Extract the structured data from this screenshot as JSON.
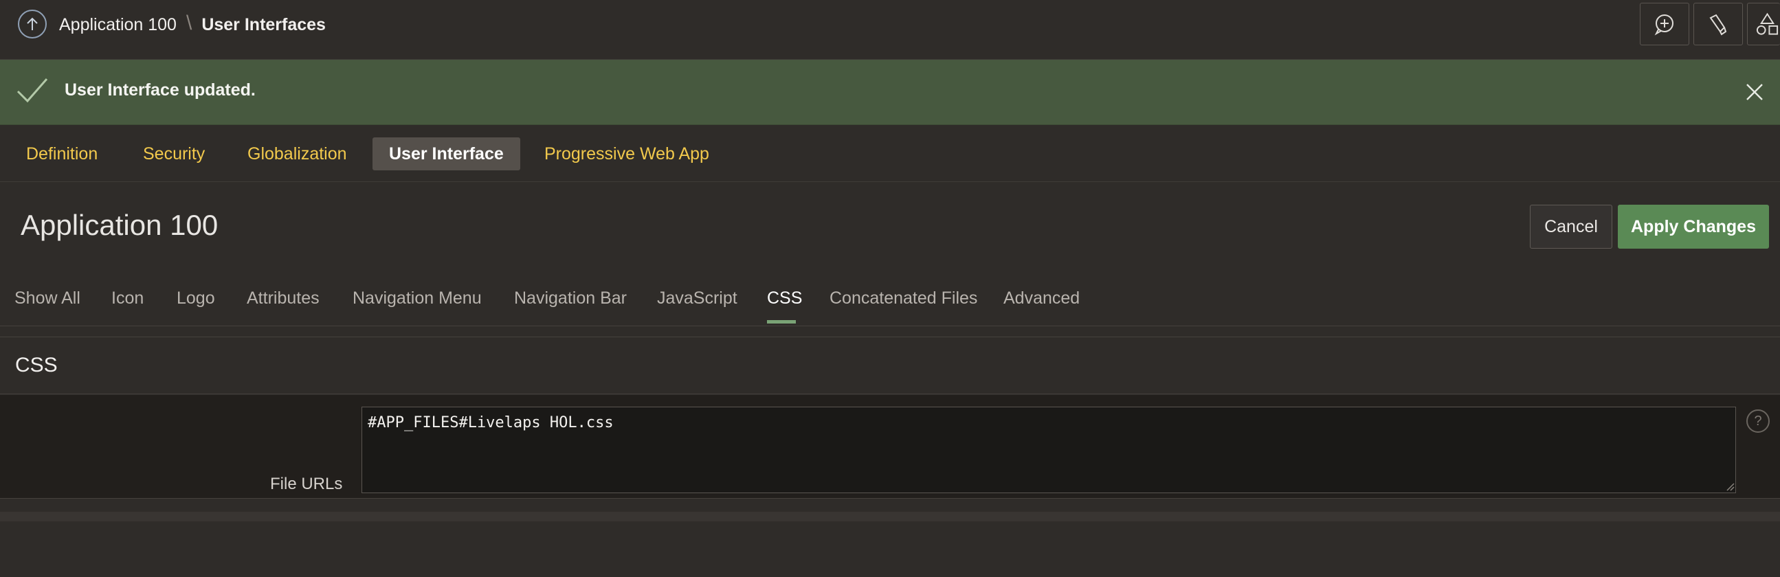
{
  "breadcrumb": {
    "items": [
      "Application 100",
      "User Interfaces"
    ],
    "separator": "\\"
  },
  "toolbar": {
    "icons": [
      "comment-add-icon",
      "highlighter-icon",
      "shapes-icon"
    ]
  },
  "alert": {
    "message": "User Interface updated.",
    "color": "#47593f"
  },
  "app_tabs": [
    {
      "label": "Definition"
    },
    {
      "label": "Security"
    },
    {
      "label": "Globalization"
    },
    {
      "label": "User Interface",
      "active": true
    },
    {
      "label": "Progressive Web App"
    }
  ],
  "page": {
    "title": "Application 100"
  },
  "actions": {
    "cancel_label": "Cancel",
    "apply_label": "Apply Changes",
    "apply_color": "#5a8a55"
  },
  "section_tabs": [
    {
      "label": "Show All"
    },
    {
      "label": "Icon"
    },
    {
      "label": "Logo"
    },
    {
      "label": "Attributes"
    },
    {
      "label": "Navigation Menu"
    },
    {
      "label": "Navigation Bar"
    },
    {
      "label": "JavaScript"
    },
    {
      "label": "CSS",
      "active": true
    },
    {
      "label": "Concatenated Files"
    },
    {
      "label": "Advanced"
    }
  ],
  "css_region": {
    "title": "CSS",
    "file_urls_label": "File URLs",
    "file_urls_value": "#APP_FILES#Livelaps HOL.css",
    "help_glyph": "?"
  }
}
